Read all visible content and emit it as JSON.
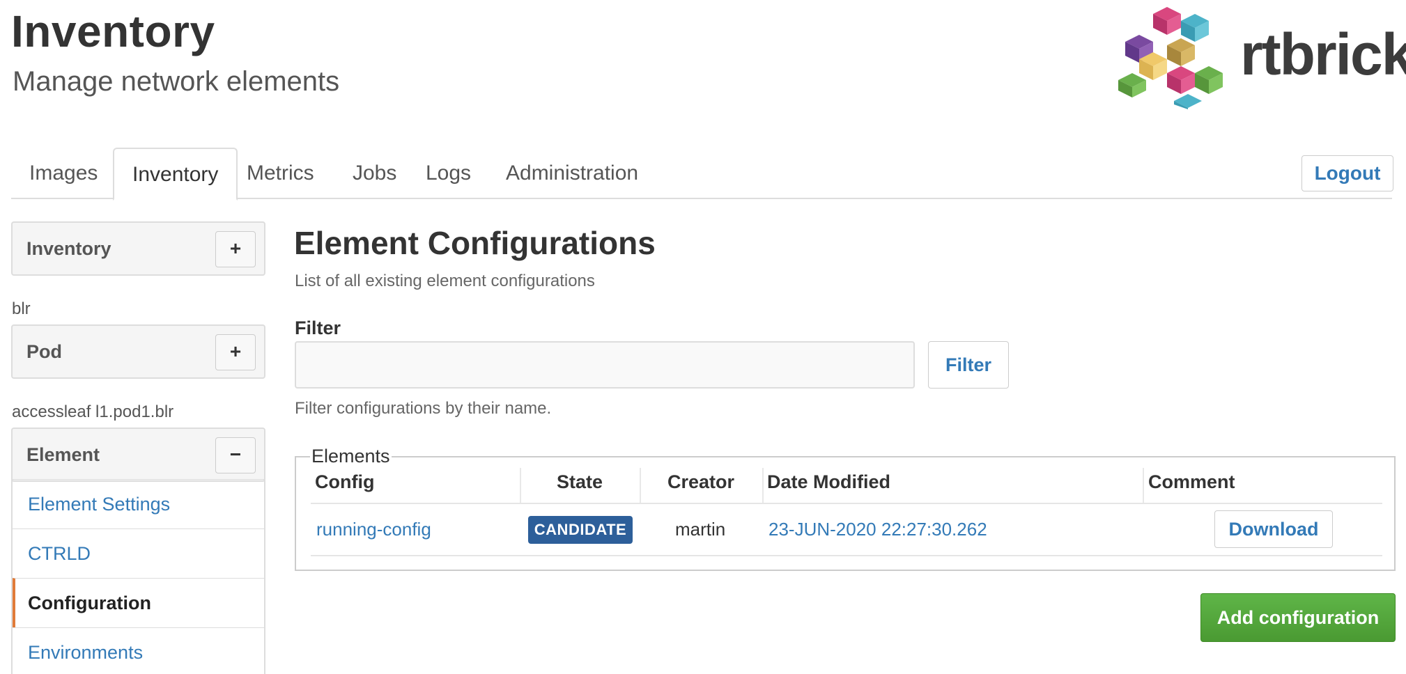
{
  "header": {
    "title": "Inventory",
    "subtitle": "Manage network elements",
    "logo_text": "rtbrick"
  },
  "tabs": [
    {
      "label": "Images"
    },
    {
      "label": "Inventory"
    },
    {
      "label": "Metrics"
    },
    {
      "label": "Jobs"
    },
    {
      "label": "Logs"
    },
    {
      "label": "Administration"
    }
  ],
  "logout_label": "Logout",
  "sidebar": {
    "inventory": {
      "label": "Inventory",
      "button": "+"
    },
    "inventory_caption": "blr",
    "pod": {
      "label": "Pod",
      "button": "+"
    },
    "pod_caption": "accessleaf l1.pod1.blr",
    "element": {
      "label": "Element",
      "button": "−"
    },
    "items": [
      {
        "label": "Element Settings"
      },
      {
        "label": "CTRLD"
      },
      {
        "label": "Configuration"
      },
      {
        "label": "Environments"
      }
    ]
  },
  "main": {
    "title": "Element Configurations",
    "description": "List of all existing element configurations",
    "filter_label": "Filter",
    "filter_value": "",
    "filter_placeholder": "",
    "filter_button": "Filter",
    "filter_help": "Filter configurations by their name.",
    "elements_legend": "Elements",
    "columns": [
      "Config",
      "State",
      "Creator",
      "Date Modified",
      "Comment"
    ],
    "rows": [
      {
        "config": "running-config",
        "state": "CANDIDATE",
        "creator": "martin",
        "date_modified": "23-JUN-2020 22:27:30.262",
        "action": "Download"
      }
    ],
    "add_button": "Add configuration"
  },
  "colors": {
    "link": "#337ab7",
    "badge": "#2d5f9a",
    "add_button": "#4a9a32",
    "active_marker": "#e07b39"
  }
}
